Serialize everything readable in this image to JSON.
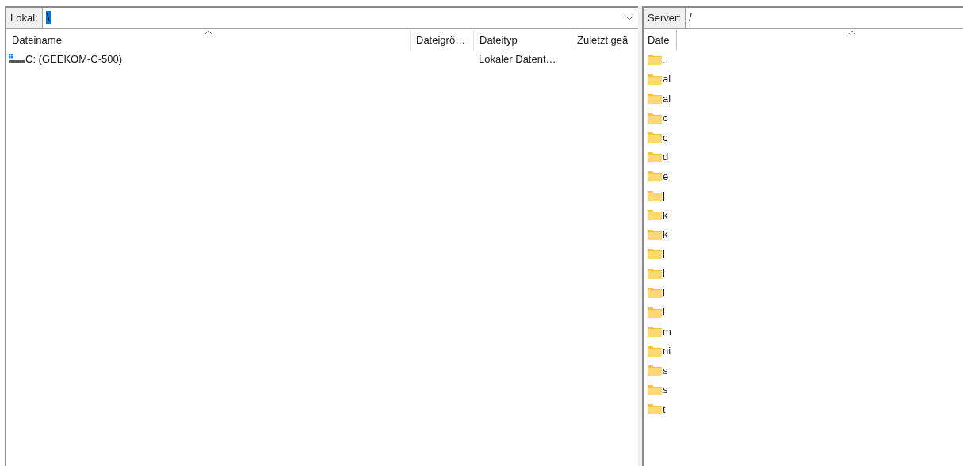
{
  "local": {
    "label": "Lokal:",
    "path": "\\",
    "columns": [
      "Dateiname",
      "Dateigrö…",
      "Dateityp",
      "Zuletzt geä"
    ],
    "rows": [
      {
        "kind": "drive",
        "name": "C: (GEEKOM-C-500)",
        "size": "",
        "type": "Lokaler Datent…",
        "modified": ""
      }
    ]
  },
  "server": {
    "label": "Server:",
    "path": "/",
    "columns": [
      "Date"
    ],
    "rows": [
      {
        "name": ".."
      },
      {
        "name": "al"
      },
      {
        "name": "al"
      },
      {
        "name": "c"
      },
      {
        "name": "c"
      },
      {
        "name": "d"
      },
      {
        "name": "e"
      },
      {
        "name": "j"
      },
      {
        "name": "k"
      },
      {
        "name": "k"
      },
      {
        "name": "l"
      },
      {
        "name": "l"
      },
      {
        "name": "l"
      },
      {
        "name": "l"
      },
      {
        "name": "m"
      },
      {
        "name": "ni"
      },
      {
        "name": "s"
      },
      {
        "name": "s"
      },
      {
        "name": "t"
      }
    ]
  }
}
